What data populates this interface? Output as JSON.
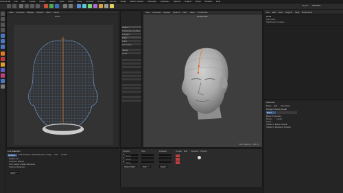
{
  "app": {
    "title": "Cinema 4D R19",
    "file_name": "Untitled 1",
    "layout": "Standard"
  },
  "menu": {
    "items": [
      "Cinema 4D",
      "File",
      "Edit",
      "Create",
      "Modes",
      "Select",
      "Tools",
      "Mesh",
      "Snap",
      "Animate",
      "Simulate",
      "Render",
      "Sculpt",
      "Motion Tracker",
      "MoGraph",
      "Character",
      "Pipeline",
      "Plugins",
      "Script",
      "Window",
      "Help"
    ],
    "layout_label": "Layout:"
  },
  "viewport_left": {
    "menu": [
      "View",
      "Cameras",
      "Display",
      "Options",
      "Filter",
      "Panel"
    ],
    "name": "Front"
  },
  "viewport_right": {
    "menu": [
      "View",
      "Cameras",
      "Display",
      "Options",
      "Filter",
      "Panel",
      "ProRender"
    ],
    "name": "Perspective",
    "grid_spacing": "Grid Spacing : 100 cm"
  },
  "middle_panel": {
    "items": [
      "Object",
      "Subdivision Surface",
      "Polygon",
      "Edge",
      "Point",
      "Symmetry",
      "Sculpt",
      "Head"
    ]
  },
  "right_panel": {
    "tabs": [
      "File",
      "Edit",
      "View",
      "Objects",
      "Tags",
      "Bookmarks"
    ],
    "objects": [
      "Head",
      "Symmetry",
      "Subdivision Surface"
    ],
    "attributes_title": "Attributes",
    "attr_tabs": [
      "Mode",
      "Edit",
      "User Data"
    ],
    "attr_object": "Polygon Object [Head]",
    "attr_section": "Basic",
    "attr_rows": [
      "Basic Properties",
      "Name  . . . . Head",
      "Layer",
      "Visible in Editor  Default",
      "Visible in Renderer  Default"
    ]
  },
  "bottom_left": {
    "title": "Live Selection",
    "tabs": [
      "Options",
      "Soft Selection",
      "Modeling Axis",
      "Image",
      "Axis",
      "Tweak"
    ],
    "rows": [
      "Radius  10",
      "Pressure Radius",
      "Only Select Visible Elements",
      "Tolerant Selection"
    ],
    "apply_label": "Apply"
  },
  "bottom_mid": {
    "headers": [
      "Position",
      "Size",
      "Rotation"
    ],
    "fields": [
      {
        "label": "X",
        "value": "0 cm"
      },
      {
        "label": "Y",
        "value": "0 cm"
      },
      {
        "label": "Z",
        "value": "0 cm"
      }
    ],
    "mode_label": "Object (Rel)",
    "size_label": "Size",
    "apply_label": "Apply",
    "materials_menu": [
      "Create",
      "Edit",
      "Function",
      "Texture"
    ]
  },
  "icons": [
    "undo-icon",
    "redo-icon",
    "live-select-icon",
    "move-icon",
    "scale-icon",
    "rotate-icon",
    "render-icon",
    "cube-icon",
    "pen-icon",
    "subdivision-icon",
    "cloner-icon",
    "camera-icon",
    "light-icon"
  ],
  "colors": {
    "background": "#262626",
    "viewport_right": "#3e3e3e",
    "accent_orange": "#e07a22",
    "wire_blue": "#6a90c8"
  }
}
